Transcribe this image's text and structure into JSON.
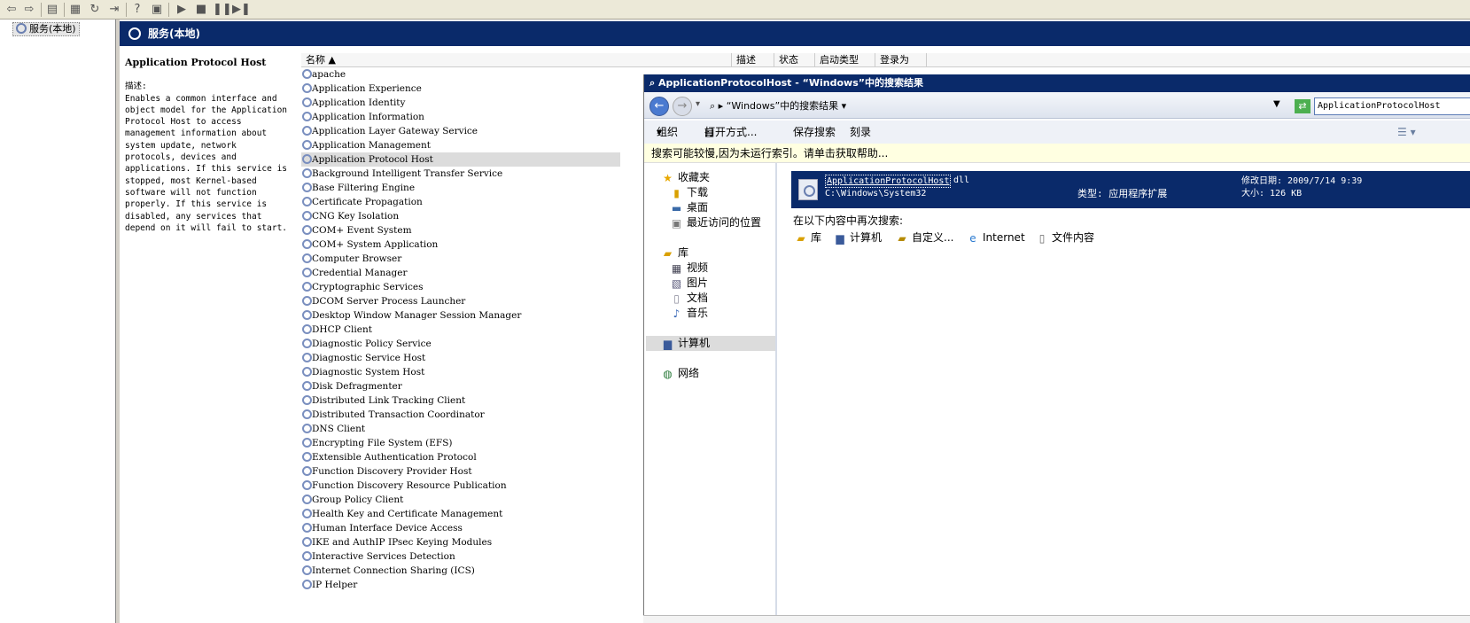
{
  "toolbar": {
    "icons": [
      "back-arrow-icon",
      "forward-arrow-icon",
      "show-hide-console-tree-icon",
      "properties-icon",
      "refresh-icon",
      "export-list-icon",
      "help-icon",
      "show-hide-action-pane-icon",
      "start-service-icon",
      "stop-service-icon",
      "pause-service-icon",
      "resume-service-icon"
    ]
  },
  "tree": {
    "node_label": "服务(本地)"
  },
  "header": {
    "title": "服务(本地)"
  },
  "description": {
    "service_name": "Application Protocol Host",
    "label": "描述:",
    "text": "Enables a common interface and\nobject model for the Application\nProtocol Host to access\nmanagement information about\nsystem update, network\nprotocols, devices and\napplications. If this service is\nstopped, most Kernel-based\nsoftware will not function\nproperly. If this service is\ndisabled, any services that\ndepend on it will fail to start."
  },
  "columns": {
    "name": "名称",
    "desc": "描述",
    "status": "状态",
    "startup": "启动类型",
    "logon": "登录为"
  },
  "services": [
    "apache",
    "Application Experience",
    "Application Identity",
    "Application Information",
    "Application Layer Gateway Service",
    "Application Management",
    "Application Protocol Host",
    "Background Intelligent Transfer Service",
    "Base Filtering Engine",
    "Certificate Propagation",
    "CNG Key Isolation",
    "COM+ Event System",
    "COM+ System Application",
    "Computer Browser",
    "Credential Manager",
    "Cryptographic Services",
    "DCOM Server Process Launcher",
    "Desktop Window Manager Session Manager",
    "DHCP Client",
    "Diagnostic Policy Service",
    "Diagnostic Service Host",
    "Diagnostic System Host",
    "Disk Defragmenter",
    "Distributed Link Tracking Client",
    "Distributed Transaction Coordinator",
    "DNS Client",
    "Encrypting File System (EFS)",
    "Extensible Authentication Protocol",
    "Function Discovery Provider Host",
    "Function Discovery Resource Publication",
    "Group Policy Client",
    "Health Key and Certificate Management",
    "Human Interface Device Access",
    "IKE and AuthIP IPsec Keying Modules",
    "Interactive Services Detection",
    "Internet Connection Sharing (ICS)",
    "IP Helper"
  ],
  "selected_service": "Application Protocol Host",
  "search": {
    "title": "ApplicationProtocolHost - “Windows”中的搜索结果",
    "address": "“Windows”中的搜索结果",
    "query": "ApplicationProtocolHost",
    "commands": {
      "organize": "组织",
      "open_with": "打开方式...",
      "save_search": "保存搜索",
      "burn": "刻录"
    },
    "info_bar": "搜索可能较慢,因为未运行索引。请单击获取帮助...",
    "nav": {
      "favorites": "收藏夹",
      "downloads": "下载",
      "desktop": "桌面",
      "recent": "最近访问的位置",
      "libraries": "库",
      "videos": "视频",
      "pictures": "图片",
      "documents": "文档",
      "music": "音乐",
      "computer": "计算机",
      "network": "网络"
    },
    "result": {
      "name": "ApplicationProtocolHost",
      "ext": "dll",
      "path": "C:\\Windows\\System32",
      "type": "类型: 应用程序扩展",
      "modified": "修改日期: 2009/7/14 9:39",
      "size": "大小: 126 KB"
    },
    "search_again_label": "在以下内容中再次搜索:",
    "search_again": {
      "libraries": "库",
      "computer": "计算机",
      "custom": "自定义...",
      "internet": "Internet",
      "file_contents": "文件内容"
    }
  }
}
